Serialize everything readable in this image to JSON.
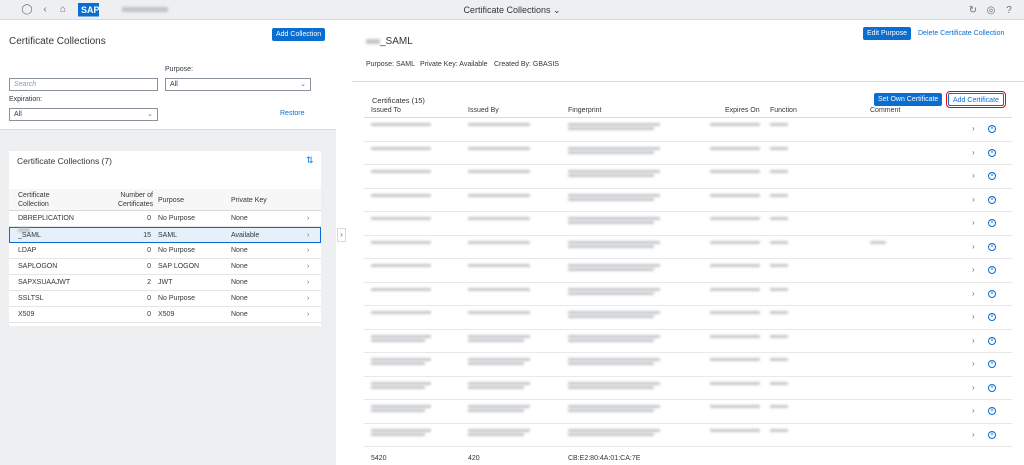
{
  "shell": {
    "title": "Certificate Collections",
    "logo": "SAP"
  },
  "left": {
    "title": "Certificate Collections",
    "add_collection": "Add Collection",
    "search_placeholder": "Search",
    "purpose_label": "Purpose:",
    "purpose_value": "All",
    "expiration_label": "Expiration:",
    "expiration_value": "All",
    "restore": "Restore",
    "list_title": "Certificate Collections (7)",
    "headers": {
      "collection": "Certificate Collection",
      "number": "Number of Certificates",
      "purpose": "Purpose",
      "private_key": "Private Key"
    },
    "rows": [
      {
        "name": "DBREPLICATION",
        "count": "0",
        "purpose": "No Purpose",
        "pk": "None"
      },
      {
        "name": "_SAML",
        "count": "15",
        "purpose": "SAML",
        "pk": "Available"
      },
      {
        "name": "LDAP",
        "count": "0",
        "purpose": "No Purpose",
        "pk": "None"
      },
      {
        "name": "SAPLOGON",
        "count": "0",
        "purpose": "SAP LOGON",
        "pk": "None"
      },
      {
        "name": "SAPXSUAAJWT",
        "count": "2",
        "purpose": "JWT",
        "pk": "None"
      },
      {
        "name": "SSLTSL",
        "count": "0",
        "purpose": "No Purpose",
        "pk": "None"
      },
      {
        "name": "X509",
        "count": "0",
        "purpose": "X509",
        "pk": "None"
      }
    ]
  },
  "right": {
    "title": "_SAML",
    "edit_purpose": "Edit Purpose",
    "delete_collection": "Delete Certificate Collection",
    "purpose": "Purpose: SAML",
    "private_key": "Private Key: Available",
    "created_by": "Created By: GBASIS",
    "certs_title": "Certificates (15)",
    "set_own": "Set Own Certificate",
    "add_cert": "Add Certificate",
    "headers": {
      "issued_to": "Issued To",
      "issued_by": "Issued By",
      "fingerprint": "Fingerprint",
      "expires": "Expires On",
      "function": "Function",
      "comment": "Comment"
    },
    "last_row": {
      "issued_to": "5420",
      "issued_by": "420",
      "fingerprint": "CB:E2:80:4A:01:CA:7E"
    }
  },
  "colors": {
    "accent": "#0a6ed1",
    "highlight": "#e00000"
  }
}
